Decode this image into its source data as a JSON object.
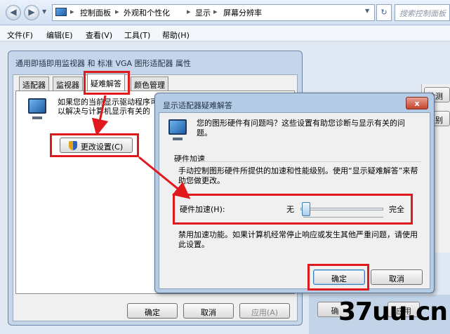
{
  "explorer": {
    "breadcrumbs": [
      "控制面板",
      "外观和个性化",
      "显示",
      "屏幕分辨率"
    ],
    "search_placeholder": "搜索控制面板",
    "menu": [
      "文件(F)",
      "编辑(E)",
      "查看(V)",
      "工具(T)",
      "帮助(H)"
    ]
  },
  "background": {
    "right_buttons": [
      "检测",
      "识别"
    ],
    "bottom_buttons": [
      "确",
      "应用"
    ]
  },
  "properties_window": {
    "title": "通用即插即用监视器 和 标准 VGA 图形适配器 属性",
    "tabs": [
      "适配器",
      "监视器",
      "疑难解答",
      "颜色管理"
    ],
    "active_tab": 2,
    "description": "如果您的当前显示驱动程序可以解决与计算机显示有关的",
    "change_settings": "更改设置(C)",
    "ok": "确定",
    "cancel": "取消",
    "apply": "应用(A)"
  },
  "dialog": {
    "title": "显示适配器疑难解答",
    "close": "x",
    "question": "您的图形硬件有问题吗？这些设置有助您诊断与显示有关的问题。",
    "group_label": "硬件加速",
    "group_desc": "手动控制图形硬件所提供的加速和性能级别。使用“显示疑难解答”来帮助您做更改。",
    "slider_label": "硬件加速(H):",
    "slider_min": "无",
    "slider_max": "完全",
    "slider_level": 0,
    "status_text": "禁用加速功能。如果计算机经常停止响应或发生其他严重问题，请使用此设置。",
    "ok": "确定",
    "cancel": "取消"
  },
  "watermark": "37uu.cn",
  "colors": {
    "highlight": "#e0191c",
    "window_frame": "#c5d6ea",
    "dialog_frame": "#b5cce7"
  }
}
